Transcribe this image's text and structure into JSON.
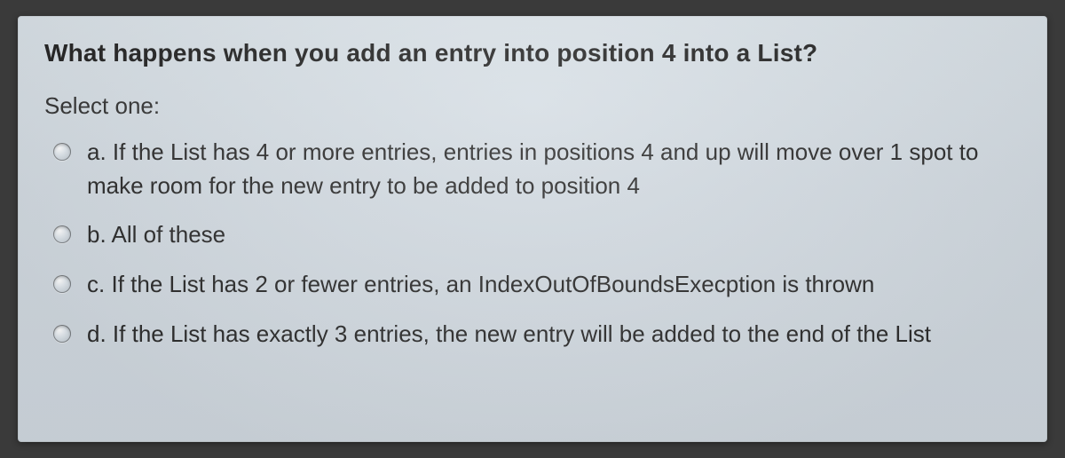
{
  "question": "What happens when you add an entry into position 4 into a List?",
  "prompt": "Select one:",
  "options": [
    {
      "letter": "a.",
      "text": "If the List has 4 or more entries, entries in positions 4 and up will move over 1 spot to make room for the new entry to be added to position 4"
    },
    {
      "letter": "b.",
      "text": "All of these"
    },
    {
      "letter": "c.",
      "text": "If the List has 2 or fewer entries, an IndexOutOfBoundsExecption is thrown"
    },
    {
      "letter": "d.",
      "text": "If the List has exactly 3 entries, the new entry will be added to the end of the List"
    }
  ]
}
